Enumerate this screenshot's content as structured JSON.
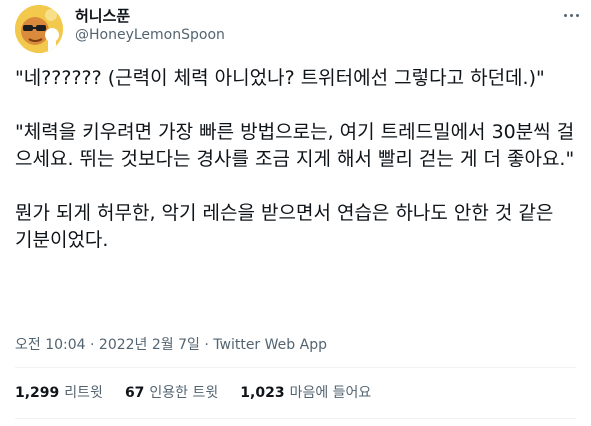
{
  "author": {
    "display_name": "허니스푼",
    "handle": "@HoneyLemonSpoon"
  },
  "tweet": {
    "paragraphs": [
      "\"네?????? (근력이 체력 아니었나? 트위터에선 그렇다고 하던데.)\"",
      "\"체력을 키우려면 가장 빠른 방법으로는, 여기 트레드밀에서 30분씩 걸으세요. 뛰는 것보다는 경사를 조금 지게 해서 빨리 걷는 게 더 좋아요.\"",
      "뭔가 되게 허무한, 악기 레슨을 받으면서 연습은 하나도 안한 것 같은 기분이었다."
    ]
  },
  "meta": {
    "time": "오전 10:04",
    "separator1": "·",
    "date": "2022년 2월 7일",
    "separator2": "·",
    "app": "Twitter Web App"
  },
  "stats": {
    "retweets_count": "1,299",
    "retweets_label": "리트윗",
    "quotes_count": "67",
    "quotes_label": "인용한 트윗",
    "likes_count": "1,023",
    "likes_label": "마음에 들어요"
  },
  "icons": {
    "more": "more-horizontal-icon"
  }
}
